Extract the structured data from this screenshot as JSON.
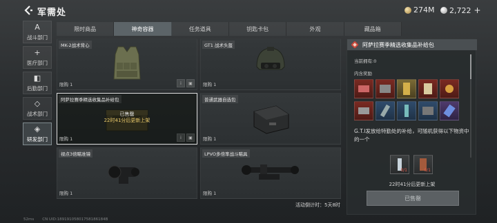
{
  "header": {
    "title": "军需处",
    "currency_gold": "274M",
    "currency_silver": "2,722",
    "plus": "+"
  },
  "leftnav": [
    {
      "label": "战斗部门",
      "icon": "A"
    },
    {
      "label": "医疗部门",
      "icon": "+"
    },
    {
      "label": "后勤部门",
      "icon": "◧"
    },
    {
      "label": "战术部门",
      "icon": "◇"
    },
    {
      "label": "研发部门",
      "icon": "◈"
    }
  ],
  "tabs": [
    "限时商品",
    "神奇容器",
    "任务道具",
    "钥匙卡包",
    "外观",
    "藏品箱"
  ],
  "items": [
    {
      "name": "MK-2战术背心",
      "limit": "限购 1"
    },
    {
      "name": "GT1 战术头盔",
      "limit": "限购 1"
    },
    {
      "name": "阿萨拉赛季精选收集品补给包",
      "limit": "限购 1",
      "sold_line1": "已售罄",
      "sold_line2": "22时41分后更新上架"
    },
    {
      "name": "普通武器自选包",
      "limit": "限购 1"
    },
    {
      "name": "视点3倍瞄准镜",
      "limit": "限购 1"
    },
    {
      "name": "LPVO多倍率战斗瞄具",
      "limit": "限购 1"
    }
  ],
  "countdown": "活动倒计时：5天8时",
  "panel": {
    "title": "阿萨拉赛季精选收集品补给包",
    "owned": "当前拥有:0",
    "contents_label": "内含奖励",
    "description": "G.T.I发放给特勤处的补给，可随机获得以下物资中的一个",
    "price_count_1": "0/1",
    "price_count_2": "0/1",
    "refresh": "22时41分后更新上架",
    "button": "已售罄"
  },
  "footer": {
    "ping": "52ms",
    "uid": "CN UID:18919105801758186184B"
  },
  "colors": {
    "accent": "#e8c86a",
    "panel_header": "#4a4f52",
    "reward_red": "#7a2a22",
    "reward_blue": "#2f4b6b"
  }
}
